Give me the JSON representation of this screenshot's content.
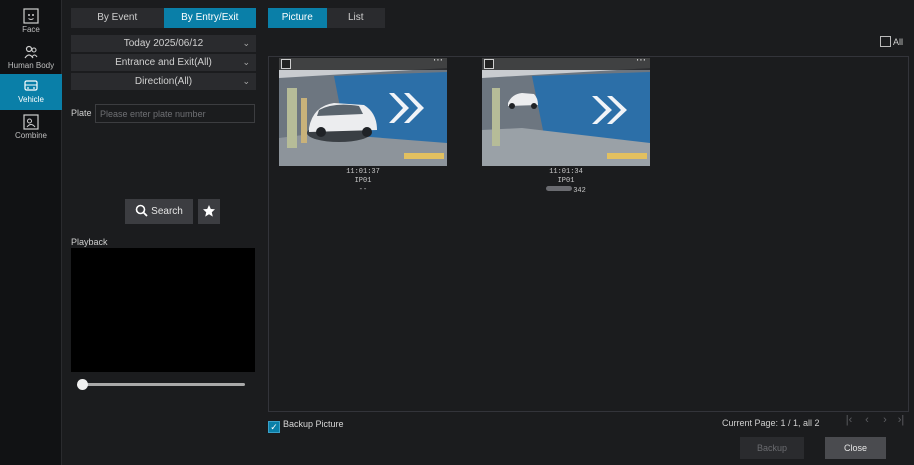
{
  "rail": [
    {
      "label": "Face",
      "icon": "face-icon"
    },
    {
      "label": "Human Body",
      "icon": "human-body-icon"
    },
    {
      "label": "Vehicle",
      "icon": "vehicle-icon",
      "active": true
    },
    {
      "label": "Combine",
      "icon": "combine-icon"
    }
  ],
  "filter": {
    "mode_tabs": [
      "By Event",
      "By Entry/Exit"
    ],
    "active_mode": "By Entry/Exit",
    "date": "Today 2025/06/12",
    "entrance": "Entrance and Exit(All)",
    "direction": "Direction(All)",
    "plate_label": "Plate",
    "plate_placeholder": "Please enter plate number",
    "search_label": "Search",
    "playback_label": "Playback",
    "playback_progress": 0
  },
  "view_tabs": [
    "Picture",
    "List"
  ],
  "active_view": "Picture",
  "select_all_label": "All",
  "results": [
    {
      "time": "11:01:37",
      "channel": "IP01",
      "plate": "--"
    },
    {
      "time": "11:01:34",
      "channel": "IP01",
      "plate": "342"
    }
  ],
  "footer": {
    "backup_picture_label": "Backup Picture",
    "backup_picture_checked": true,
    "page_info": "Current Page: 1 / 1, all 2",
    "backup_button": "Backup",
    "close_button": "Close"
  },
  "colors": {
    "accent": "#0a7fa8",
    "background": "#1b1c1e"
  }
}
